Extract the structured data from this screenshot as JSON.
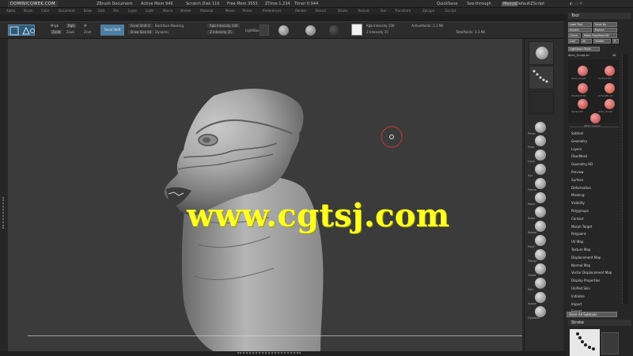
{
  "app": {
    "title_segments": [
      "ZBrush Document",
      "Active Mem 949",
      "Scratch Disk 116",
      "Free Mem 3555",
      "ZTime 1.234",
      "Timer 0.944"
    ],
    "watermark_url": "DOMINICQWEK.COM",
    "quicksave": "QuickSave",
    "see_through": "See-through",
    "menus": "Menus",
    "default_zscript": "DefaultZScript"
  },
  "menubar": [
    "Alpha",
    "Brush",
    "Color",
    "Document",
    "Draw",
    "Edit",
    "File",
    "Layer",
    "Light",
    "Macro",
    "Marker",
    "Material",
    "Movie",
    "Picker",
    "Preferences",
    "Render",
    "Stencil",
    "Stroke",
    "Texture",
    "Tool",
    "Transform",
    "Zplugin",
    "Zscript"
  ],
  "toolbar": {
    "mode_icons": [
      "Edit",
      "Draw"
    ],
    "mrgb": "Mrgb",
    "rgb": "Rgb",
    "m": "M",
    "zadd": "Zadd",
    "zsub": "Zsub",
    "zcut": "Zcut",
    "brush_button": "Focal Shift",
    "focal_shift": "Focal Shift 0",
    "draw_size": "Draw Size 64",
    "backface": "Backface Masking",
    "dynamic": "Dynamic",
    "rgb_intensity": "Rgb Intensity 100",
    "z_intensity": "Z Intensity 25",
    "active_points": "ActivePoints: 2.1 Mil",
    "total_points": "TotalPoints: 3.3 Mil",
    "lights": "LightBox",
    "lazy": "Lazy Mouse"
  },
  "canvas": {
    "website_watermark": "www.cgtsj.com"
  },
  "shelf": {
    "labels": [
      "Persp",
      "Floor",
      "Local",
      "Xyz",
      "Frame",
      "Move",
      "Scale",
      "Rotate",
      "PolyF",
      "Transp",
      "Ghost",
      "Solo",
      "Xpose",
      "Dynamic"
    ]
  },
  "tool": {
    "title": "Tool",
    "buttons": [
      "Load Tool",
      "Save As",
      "Import",
      "Export",
      "Clone",
      "Make PolyMesh3D",
      "GoZ",
      "All",
      "Visible",
      "R",
      "Lightbox>Tools"
    ],
    "current_tool": "Alien_Sculpt.ztl",
    "tool_count": "48",
    "thumbnails": [
      {
        "caption": "Alien_Sculpt",
        "color": "#b04545"
      },
      {
        "caption": "Cylinder3D",
        "color": "#c44040"
      },
      {
        "caption": "PolyMesh3D",
        "color": "#c03a3a"
      },
      {
        "caption": "SimpleBrush",
        "color": "#d05030"
      },
      {
        "caption": "Sphere3D",
        "color": "#b03030"
      },
      {
        "caption": "Alien_Sculpt",
        "color": "#c04a3a"
      },
      {
        "caption": "PM3D_Sphere",
        "color": "#b84040"
      }
    ],
    "subpalettes": [
      "Subtool",
      "Geometry",
      "Layers",
      "FiberMesh",
      "Geometry HD",
      "Preview",
      "Surface",
      "Deformation",
      "Masking",
      "Visibility",
      "Polygroups",
      "Contact",
      "Morph Target",
      "Polypaint",
      "UV Map",
      "Texture Map",
      "Displacement Map",
      "Normal Map",
      "Vector Displacement Map",
      "Display Properties",
      "Unified Skin",
      "Initialize",
      "Import",
      "Export"
    ],
    "store_button": "Store All Subtools",
    "stroke_title": "Stroke"
  }
}
